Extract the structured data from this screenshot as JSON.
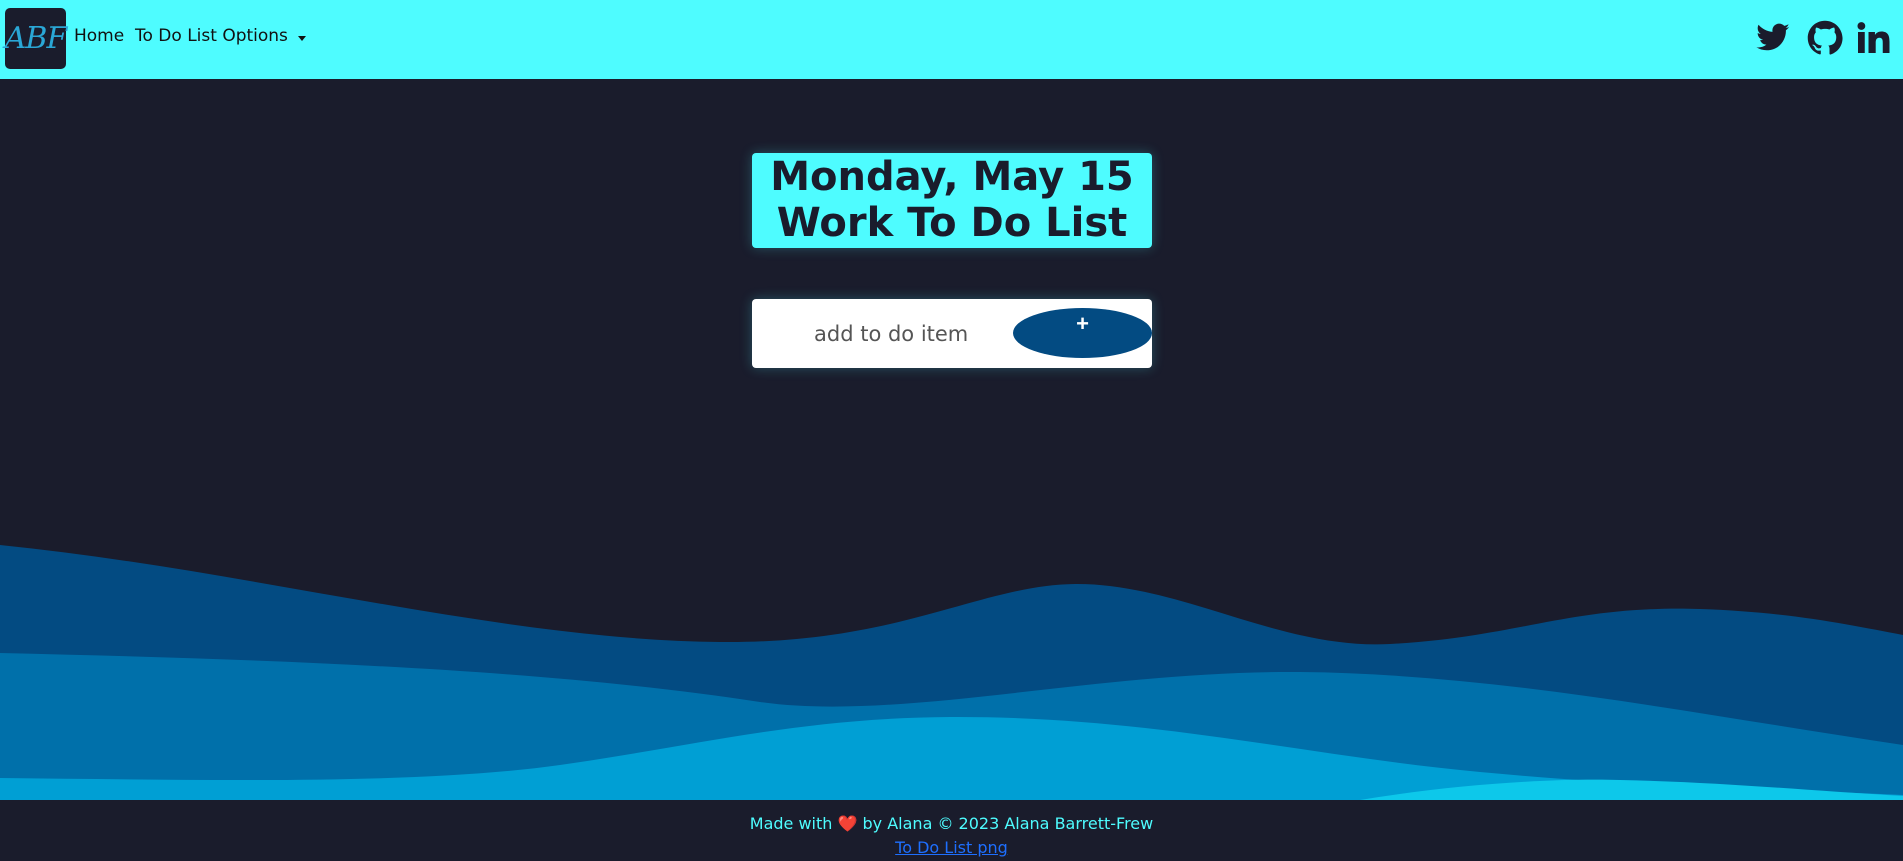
{
  "navbar": {
    "logo_text": "ABF",
    "home_label": "Home",
    "options_label": "To Do List Options",
    "social": [
      "twitter-icon",
      "github-icon",
      "linkedin-icon"
    ]
  },
  "title": {
    "date": "Monday, May 15",
    "list_name": "Work To Do List"
  },
  "add_item": {
    "placeholder": "add to do item",
    "button_label": "+"
  },
  "footer": {
    "made_with_prefix": "Made with",
    "heart": "❤️",
    "made_with_suffix": "by Alana © 2023 Alana Barrett-Frew",
    "link_text": "To Do List png"
  },
  "colors": {
    "accent": "#4efcff",
    "background": "#1a1c2c",
    "button": "#034b82",
    "wave_dark": "#034b82",
    "wave_mid": "#0070aa",
    "wave_light": "#009fd4",
    "wave_lightest": "#0dc8ea"
  }
}
